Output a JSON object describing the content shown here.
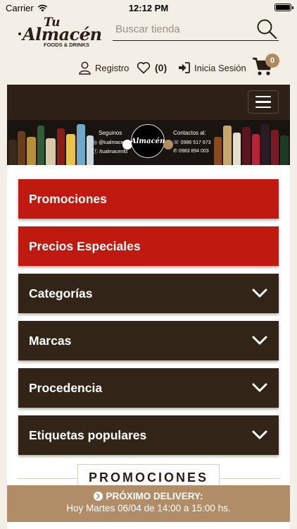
{
  "status": {
    "carrier": "Carrier",
    "time": "12:12 PM"
  },
  "logo": {
    "line1": "Tu",
    "line2": "Almacén",
    "line3": "FOODS & DRINKS"
  },
  "search": {
    "placeholder": "Buscar tienda"
  },
  "userbar": {
    "register": "Registro",
    "wishlist_count": "(0)",
    "login": "Inicia Sesión",
    "cart_count": "0"
  },
  "banner": {
    "follow": "Seguinos",
    "instagram": "@tualmacen",
    "facebook": "/tualmacenfd",
    "logo_text": "Almacén",
    "contact": "Contactos al:",
    "phone1": "0986 517 673",
    "phone2": "0983 894 003"
  },
  "menu": [
    {
      "label": "Promociones",
      "style": "red",
      "expandable": false
    },
    {
      "label": "Precios Especiales",
      "style": "red",
      "expandable": false
    },
    {
      "label": "Categorías",
      "style": "brown",
      "expandable": true
    },
    {
      "label": "Marcas",
      "style": "brown",
      "expandable": true
    },
    {
      "label": "Procedencia",
      "style": "brown",
      "expandable": true
    },
    {
      "label": "Etiquetas populares",
      "style": "brown",
      "expandable": true
    }
  ],
  "section_title": "PROMOCIONES",
  "delivery": {
    "title": "PRÓXIMO DELIVERY:",
    "detail": "Hoy Martes 06/04 de 14:00 a 15:00 hs."
  },
  "colors": {
    "red": "#c0190f",
    "brown": "#332418",
    "accent": "#b08d66",
    "background": "#f3efe6"
  }
}
